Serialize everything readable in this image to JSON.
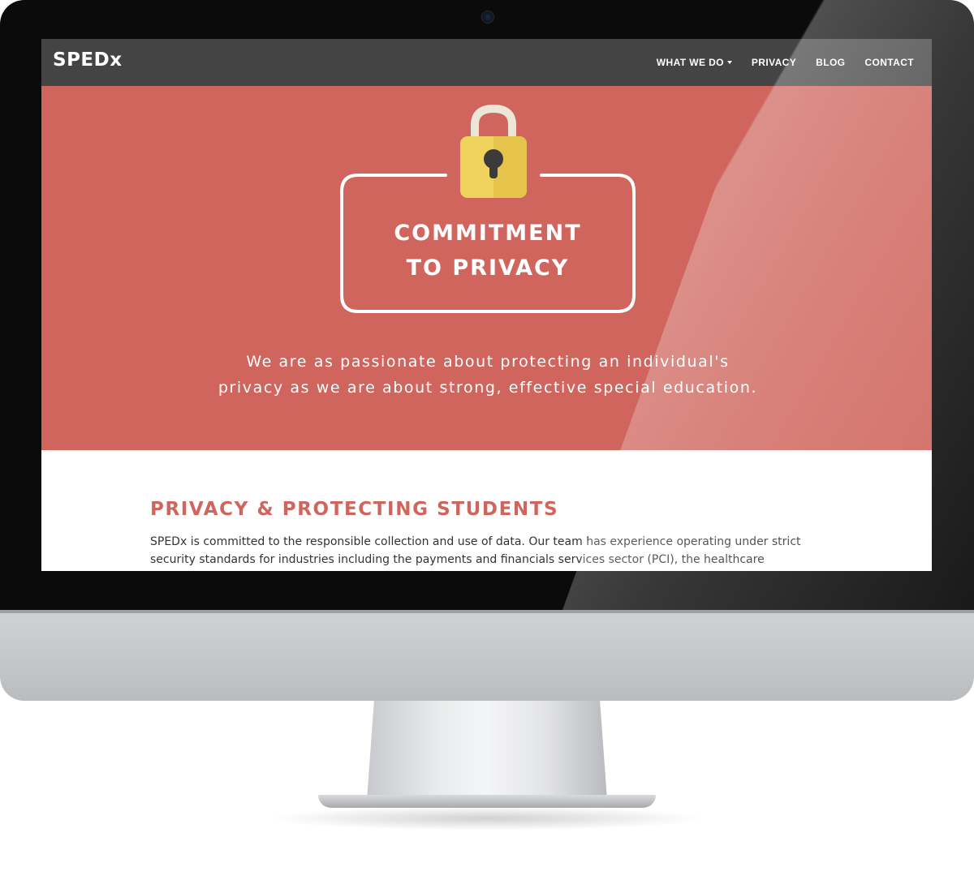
{
  "colors": {
    "accent": "#cf655d",
    "navbar": "#444444",
    "lock_body": "#f0d35c",
    "lock_shackle": "#ece6d6",
    "keyhole": "#3b3b3b"
  },
  "navbar": {
    "brand": "SPEDx",
    "items": [
      {
        "label": "WHAT WE DO",
        "has_dropdown": true
      },
      {
        "label": "PRIVACY"
      },
      {
        "label": "BLOG"
      },
      {
        "label": "CONTACT"
      }
    ]
  },
  "hero": {
    "icon": "padlock-icon",
    "title_line1": "COMMITMENT",
    "title_line2": "TO PRIVACY",
    "text_line1": "We are as passionate about protecting an individual's",
    "text_line2": "privacy as we are about strong, effective special education."
  },
  "section": {
    "heading": "PRIVACY & PROTECTING STUDENTS",
    "body_line1": "SPEDx is committed to the responsible collection and use of data. Our team has experience operating under strict",
    "body_line2": "security standards for industries including the payments and financials services sector (PCI), the healthcare"
  }
}
